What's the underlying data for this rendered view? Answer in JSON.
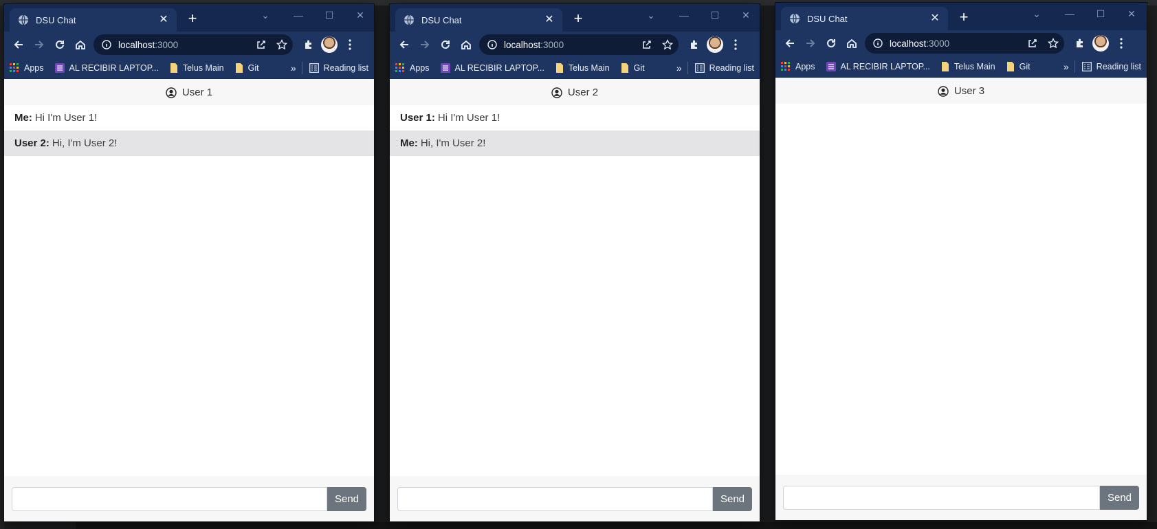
{
  "windows": [
    {
      "tab_title": "DSU Chat",
      "url_host": "localhost",
      "url_port": ":3000",
      "bookmarks": [
        "Apps",
        "AL RECIBIR LAPTOP...",
        "Telus Main",
        "Git"
      ],
      "reading_list": "Reading list",
      "user_label": "User 1",
      "messages": [
        {
          "sender": "Me:",
          "text": "Hi I'm User 1!"
        },
        {
          "sender": "User 2:",
          "text": "Hi, I'm User 2!"
        }
      ],
      "input_value": "",
      "send_label": "Send"
    },
    {
      "tab_title": "DSU Chat",
      "url_host": "localhost",
      "url_port": ":3000",
      "bookmarks": [
        "Apps",
        "AL RECIBIR LAPTOP...",
        "Telus Main",
        "Git"
      ],
      "reading_list": "Reading list",
      "user_label": "User 2",
      "messages": [
        {
          "sender": "User 1:",
          "text": "Hi I'm User 1!"
        },
        {
          "sender": "Me:",
          "text": "Hi, I'm User 2!"
        }
      ],
      "input_value": "",
      "send_label": "Send"
    },
    {
      "tab_title": "DSU Chat",
      "url_host": "localhost",
      "url_port": ":3000",
      "bookmarks": [
        "Apps",
        "AL RECIBIR LAPTOP...",
        "Telus Main",
        "Git"
      ],
      "reading_list": "Reading list",
      "user_label": "User 3",
      "messages": [],
      "input_value": "",
      "send_label": "Send"
    }
  ],
  "colors": {
    "titlebar": "#142850",
    "toolbar": "#1e3561",
    "send_button": "#6c757d",
    "alt_row": "#e4e4e6"
  }
}
